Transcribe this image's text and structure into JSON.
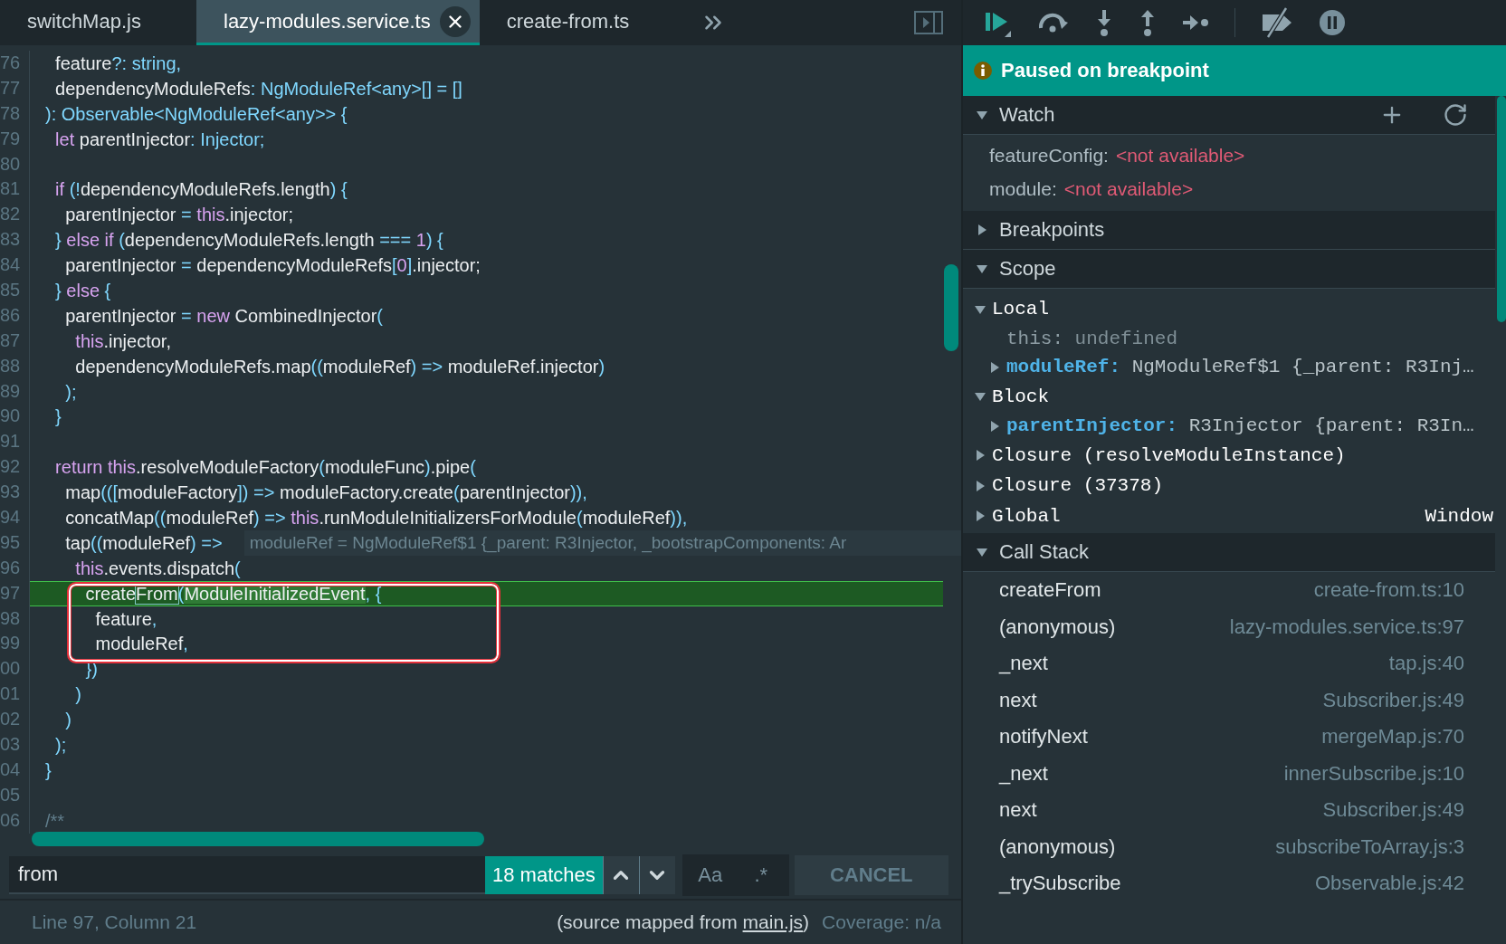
{
  "tabs": [
    {
      "label": "switchMap.js",
      "selected": false
    },
    {
      "label": "lazy-modules.service.ts",
      "selected": true
    },
    {
      "label": "create-from.ts",
      "selected": false
    }
  ],
  "code": {
    "lines": [
      {
        "number": "76",
        "current": false,
        "tokens": [
          {
            "kind": "plain",
            "text": "  feature"
          },
          {
            "kind": "type",
            "text": "?: string,"
          }
        ]
      },
      {
        "number": "77",
        "current": false,
        "tokens": [
          {
            "kind": "plain",
            "text": "  dependencyModuleRefs"
          },
          {
            "kind": "type",
            "text": ": NgModuleRef<any>[] = []"
          }
        ]
      },
      {
        "number": "78",
        "current": false,
        "tokens": [
          {
            "kind": "type",
            "text": "): Observable<NgModuleRef<any>> {"
          }
        ]
      },
      {
        "number": "79",
        "current": false,
        "tokens": [
          {
            "kind": "keyword",
            "text": "  let"
          },
          {
            "kind": "plain",
            "text": " parentInjector"
          },
          {
            "kind": "type",
            "text": ": Injector;"
          }
        ]
      },
      {
        "number": "80",
        "current": false
      },
      {
        "number": "81",
        "current": false,
        "tokens": [
          {
            "kind": "keyword",
            "text": "  if"
          },
          {
            "kind": "type",
            "text": " (!"
          },
          {
            "kind": "plain",
            "text": "dependencyModuleRefs.length"
          },
          {
            "kind": "type",
            "text": ") {"
          }
        ]
      },
      {
        "number": "82",
        "current": false,
        "tokens": [
          {
            "kind": "plain",
            "text": "    parentInjector "
          },
          {
            "kind": "type",
            "text": "="
          },
          {
            "kind": "keyword",
            "text": " this"
          },
          {
            "kind": "plain",
            "text": ".injector;"
          }
        ]
      },
      {
        "number": "83",
        "current": false,
        "tokens": [
          {
            "kind": "type",
            "text": "  }"
          },
          {
            "kind": "keyword",
            "text": " else if"
          },
          {
            "kind": "type",
            "text": " ("
          },
          {
            "kind": "plain",
            "text": "dependencyModuleRefs.length "
          },
          {
            "kind": "type",
            "text": "==="
          },
          {
            "kind": "keyword",
            "text": " 1"
          },
          {
            "kind": "type",
            "text": ") {"
          }
        ]
      },
      {
        "number": "84",
        "current": false,
        "tokens": [
          {
            "kind": "plain",
            "text": "    parentInjector "
          },
          {
            "kind": "type",
            "text": "="
          },
          {
            "kind": "plain",
            "text": " dependencyModuleRefs"
          },
          {
            "kind": "type",
            "text": "["
          },
          {
            "kind": "keyword",
            "text": "0"
          },
          {
            "kind": "type",
            "text": "]"
          },
          {
            "kind": "plain",
            "text": ".injector;"
          }
        ]
      },
      {
        "number": "85",
        "current": false,
        "tokens": [
          {
            "kind": "type",
            "text": "  }"
          },
          {
            "kind": "keyword",
            "text": " else"
          },
          {
            "kind": "type",
            "text": " {"
          }
        ]
      },
      {
        "number": "86",
        "current": false,
        "tokens": [
          {
            "kind": "plain",
            "text": "    parentInjector "
          },
          {
            "kind": "type",
            "text": "="
          },
          {
            "kind": "keyword",
            "text": " new"
          },
          {
            "kind": "plain",
            "text": " CombinedInjector"
          },
          {
            "kind": "type",
            "text": "("
          }
        ]
      },
      {
        "number": "87",
        "current": false,
        "tokens": [
          {
            "kind": "keyword",
            "text": "      this"
          },
          {
            "kind": "plain",
            "text": ".injector,"
          }
        ]
      },
      {
        "number": "88",
        "current": false,
        "tokens": [
          {
            "kind": "plain",
            "text": "      dependencyModuleRefs.map"
          },
          {
            "kind": "type",
            "text": "(("
          },
          {
            "kind": "plain",
            "text": "moduleRef"
          },
          {
            "kind": "type",
            "text": ") =>"
          },
          {
            "kind": "plain",
            "text": " moduleRef.injector"
          },
          {
            "kind": "type",
            "text": ")"
          }
        ]
      },
      {
        "number": "89",
        "current": false,
        "tokens": [
          {
            "kind": "type",
            "text": "    );"
          }
        ]
      },
      {
        "number": "90",
        "current": false,
        "tokens": [
          {
            "kind": "type",
            "text": "  }"
          }
        ]
      },
      {
        "number": "91",
        "current": false
      },
      {
        "number": "92",
        "current": false,
        "tokens": [
          {
            "kind": "keyword",
            "text": "  return this"
          },
          {
            "kind": "plain",
            "text": ".resolveModuleFactory"
          },
          {
            "kind": "type",
            "text": "("
          },
          {
            "kind": "plain",
            "text": "moduleFunc"
          },
          {
            "kind": "type",
            "text": ")"
          },
          {
            "kind": "plain",
            "text": ".pipe"
          },
          {
            "kind": "type",
            "text": "("
          }
        ]
      },
      {
        "number": "93",
        "current": false,
        "tokens": [
          {
            "kind": "plain",
            "text": "    map"
          },
          {
            "kind": "type",
            "text": "((["
          },
          {
            "kind": "plain",
            "text": "moduleFactory"
          },
          {
            "kind": "type",
            "text": "]) =>"
          },
          {
            "kind": "plain",
            "text": " moduleFactory.create"
          },
          {
            "kind": "type",
            "text": "("
          },
          {
            "kind": "plain",
            "text": "parentInjector"
          },
          {
            "kind": "type",
            "text": ")),"
          }
        ]
      },
      {
        "number": "94",
        "current": false,
        "tokens": [
          {
            "kind": "plain",
            "text": "    concatMap"
          },
          {
            "kind": "type",
            "text": "(("
          },
          {
            "kind": "plain",
            "text": "moduleRef"
          },
          {
            "kind": "type",
            "text": ") =>"
          },
          {
            "kind": "keyword",
            "text": " this"
          },
          {
            "kind": "plain",
            "text": ".runModuleInitializersForModule"
          },
          {
            "kind": "type",
            "text": "("
          },
          {
            "kind": "plain",
            "text": "moduleRef"
          },
          {
            "kind": "type",
            "text": ")),"
          }
        ]
      },
      {
        "number": "95",
        "current": false,
        "tokens": [
          {
            "kind": "plain",
            "text": "    tap"
          },
          {
            "kind": "type",
            "text": "(("
          },
          {
            "kind": "plain",
            "text": "moduleRef"
          },
          {
            "kind": "type",
            "text": ") =>"
          }
        ],
        "inline_value": "moduleRef = NgModuleRef$1 {_parent: R3Injector, _bootstrapComponents: Ar"
      },
      {
        "number": "96",
        "current": false,
        "tokens": [
          {
            "kind": "keyword",
            "text": "      this"
          },
          {
            "kind": "plain",
            "text": ".events.dispatch"
          },
          {
            "kind": "type",
            "text": "("
          }
        ]
      },
      {
        "number": "97",
        "current": true,
        "tokens": [
          {
            "kind": "plain",
            "text": "        create"
          },
          {
            "kind": "match",
            "text": "From"
          },
          {
            "kind": "type",
            "text": "("
          },
          {
            "kind": "evaluated",
            "text": "ModuleInitializedEvent"
          },
          {
            "kind": "type",
            "text": ", {"
          }
        ]
      },
      {
        "number": "98",
        "current": false,
        "tokens": [
          {
            "kind": "plain",
            "text": "          feature"
          },
          {
            "kind": "type",
            "text": ","
          }
        ]
      },
      {
        "number": "99",
        "current": false,
        "tokens": [
          {
            "kind": "plain",
            "text": "          moduleRef"
          },
          {
            "kind": "type",
            "text": ","
          }
        ]
      },
      {
        "number": "00",
        "current": false,
        "tokens": [
          {
            "kind": "type",
            "text": "        })"
          }
        ]
      },
      {
        "number": "01",
        "current": false,
        "tokens": [
          {
            "kind": "type",
            "text": "      )"
          }
        ]
      },
      {
        "number": "02",
        "current": false,
        "tokens": [
          {
            "kind": "type",
            "text": "    )"
          }
        ]
      },
      {
        "number": "03",
        "current": false,
        "tokens": [
          {
            "kind": "type",
            "text": "  );"
          }
        ]
      },
      {
        "number": "04",
        "current": false,
        "tokens": [
          {
            "kind": "type",
            "text": "}"
          }
        ]
      },
      {
        "number": "05",
        "current": false
      },
      {
        "number": "06",
        "current": false,
        "tokens": [
          {
            "kind": "comment",
            "text": "/**"
          }
        ]
      }
    ]
  },
  "search": {
    "value": "from",
    "match_count": "18 matches",
    "options": [
      {
        "label": "Aa",
        "selected": false
      },
      {
        "label": ".*",
        "selected": false
      }
    ],
    "cancel": "CANCEL"
  },
  "status_bar": {
    "position": "Line 97, Column 21",
    "source_before": "(source mapped from ",
    "source_link": "main.js",
    "source_after": ")",
    "coverage": "Coverage: n/a"
  },
  "banner": {
    "text": "Paused on breakpoint"
  },
  "watch": {
    "title": "Watch",
    "expanded": true,
    "items": [
      {
        "name": "featureConfig:",
        "value": "<not available>"
      },
      {
        "name": "module:",
        "value": "<not available>"
      }
    ]
  },
  "breakpoints": {
    "title": "Breakpoints",
    "expanded": false
  },
  "scope": {
    "title": "Scope",
    "expanded": true,
    "items": [
      {
        "name": "Local",
        "expanded": true,
        "children": [
          {
            "kind": "primitive",
            "name": "this:",
            "value": "undefined"
          },
          {
            "kind": "object",
            "name": "moduleRef:",
            "value": "NgModuleRef$1 {_parent: R3Inj…",
            "expanded": false
          }
        ]
      },
      {
        "name": "Block",
        "expanded": true,
        "children": [
          {
            "kind": "object",
            "name": "parentInjector:",
            "value": "R3Injector {parent: R3In…",
            "expanded": false
          }
        ]
      },
      {
        "name": "Closure (resolveModuleInstance)",
        "expanded": false
      },
      {
        "name": "Closure (37378)",
        "expanded": false
      },
      {
        "name": "Global",
        "expanded": false,
        "value": "Window"
      }
    ]
  },
  "call_stack": {
    "title": "Call Stack",
    "expanded": true,
    "frames": [
      {
        "function": "createFrom",
        "location": "create-from.ts:10"
      },
      {
        "function": "(anonymous)",
        "location": "lazy-modules.service.ts:97"
      },
      {
        "function": "_next",
        "location": "tap.js:40"
      },
      {
        "function": "next",
        "location": "Subscriber.js:49"
      },
      {
        "function": "notifyNext",
        "location": "mergeMap.js:70"
      },
      {
        "function": "_next",
        "location": "innerSubscribe.js:10"
      },
      {
        "function": "next",
        "location": "Subscriber.js:49"
      },
      {
        "function": "(anonymous)",
        "location": "subscribeToArray.js:3"
      },
      {
        "function": "_trySubscribe",
        "location": "Observable.js:42"
      }
    ]
  }
}
